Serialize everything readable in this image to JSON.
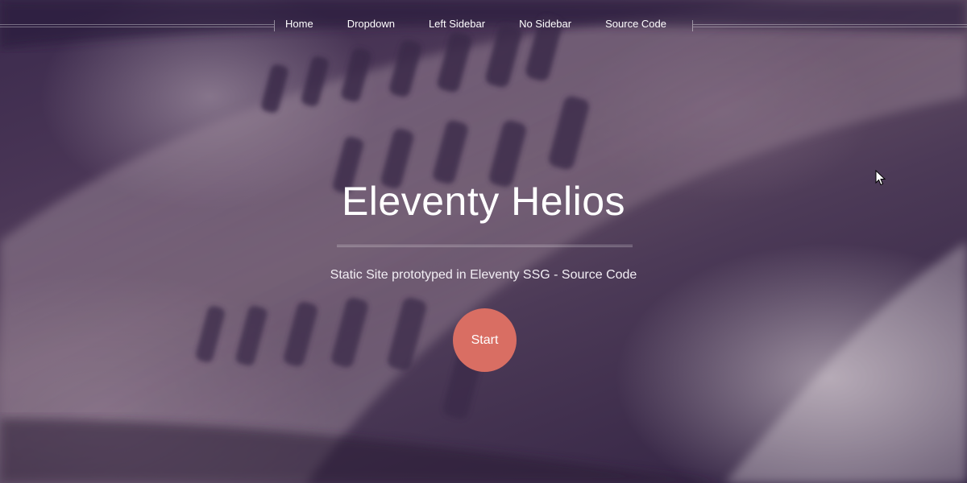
{
  "nav": {
    "items": [
      {
        "label": "Home"
      },
      {
        "label": "Dropdown"
      },
      {
        "label": "Left Sidebar"
      },
      {
        "label": "No Sidebar"
      },
      {
        "label": "Source Code"
      }
    ]
  },
  "hero": {
    "title": "Eleventy Helios",
    "subtitle": "Static Site prototyped in Eleventy SSG - Source Code",
    "start_label": "Start"
  },
  "colors": {
    "accent": "#d96e63",
    "overlay": "#3b2a4d"
  },
  "icons": {
    "cursor": "mouse-pointer-icon"
  }
}
